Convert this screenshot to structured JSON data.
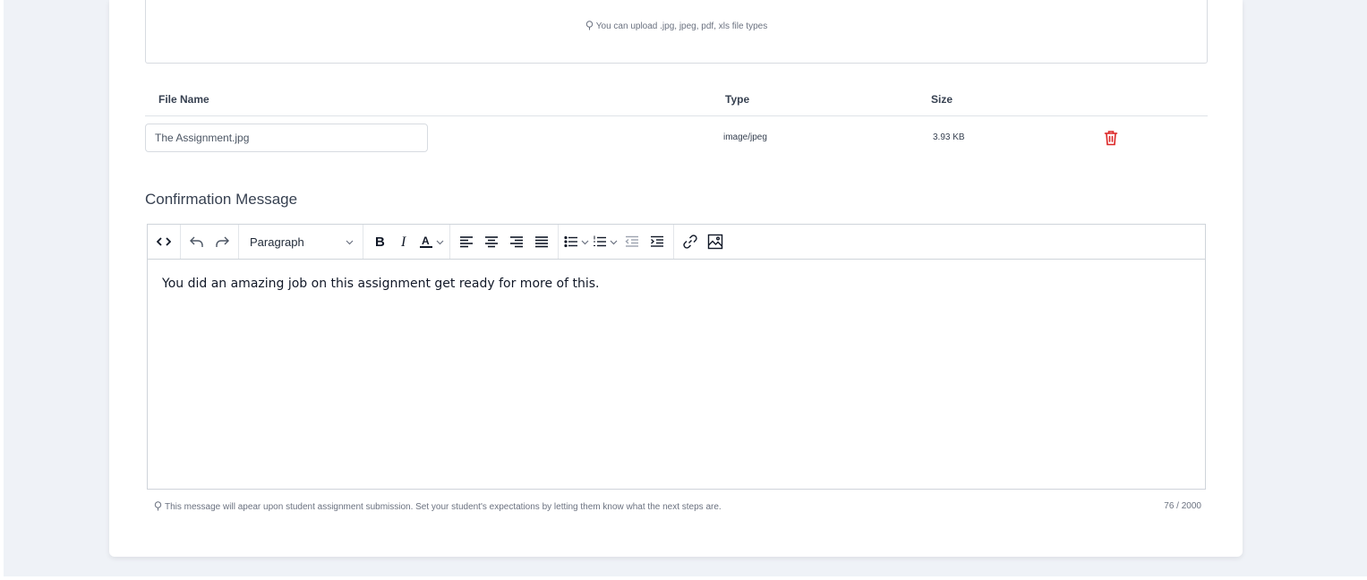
{
  "upload": {
    "hint": "You can upload .jpg, jpeg, pdf, xls file types"
  },
  "files_table": {
    "headers": {
      "name": "File Name",
      "type": "Type",
      "size": "Size"
    },
    "rows": [
      {
        "name": "The Assignment.jpg",
        "type": "image/jpeg",
        "size": "3.93 KB"
      }
    ]
  },
  "confirmation": {
    "title": "Confirmation Message",
    "toolbar": {
      "block_format": "Paragraph"
    },
    "content": "You did an amazing job on this assignment get ready for more of this.",
    "hint": "This message will apear upon student assignment submission. Set your student's expectations by letting them know what the next steps are.",
    "char_count": "76 / 2000"
  },
  "colors": {
    "delete_icon": "#dc2626",
    "border": "#d7dbe1",
    "muted_text": "#6b7280"
  }
}
